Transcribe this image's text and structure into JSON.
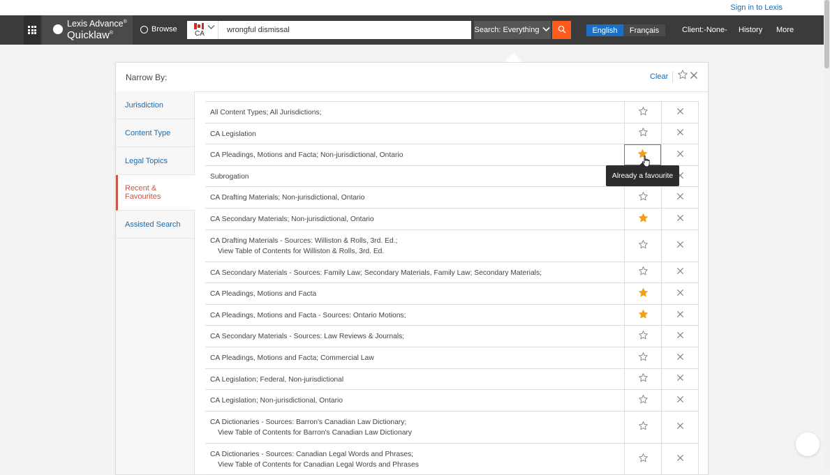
{
  "header": {
    "signin": "Sign in to Lexis",
    "brand_line1": "Lexis Advance",
    "brand_line2": "Quicklaw",
    "brand_mark": "®",
    "browse": "Browse",
    "country": "CA",
    "search_value": "wrongful dismissal",
    "scope": "Search: Everything",
    "lang_en": "English",
    "lang_fr": "Français",
    "client": "Client:-None-",
    "history": "History",
    "more": "More",
    "accent_color": "#ff5b1a",
    "active_lang_color": "#1a6fc7"
  },
  "panel": {
    "title": "Narrow By:",
    "clear": "Clear"
  },
  "sidebar": {
    "items": [
      {
        "label": "Jurisdiction"
      },
      {
        "label": "Content Type"
      },
      {
        "label": "Legal Topics"
      },
      {
        "label": "Recent &\nFavourites"
      },
      {
        "label": "Assisted Search"
      }
    ],
    "active_index": 3
  },
  "rows": [
    {
      "text": "All Content Types; All Jurisdictions;",
      "fav": false
    },
    {
      "text": "CA Legislation",
      "fav": false
    },
    {
      "text": "CA Pleadings, Motions and Facta; Non-jurisdictional, Ontario",
      "fav": true,
      "focused": true
    },
    {
      "text": "Subrogation",
      "fav": false
    },
    {
      "text": "CA Drafting Materials; Non-jurisdictional, Ontario",
      "fav": false
    },
    {
      "text": "CA Secondary Materials; Non-jurisdictional, Ontario",
      "fav": true
    },
    {
      "text": "CA Drafting Materials - Sources: Williston & Rolls, 3rd. Ed.;",
      "sub": "View Table of Contents for Williston & Rolls, 3rd. Ed.",
      "fav": false
    },
    {
      "text": "CA Secondary Materials - Sources: Family Law; Secondary Materials, Family Law; Secondary Materials;",
      "fav": false
    },
    {
      "text": "CA Pleadings, Motions and Facta",
      "fav": true
    },
    {
      "text": "CA Pleadings, Motions and Facta - Sources: Ontario Motions;",
      "fav": true
    },
    {
      "text": "CA Secondary Materials - Sources: Law Reviews & Journals;",
      "fav": false
    },
    {
      "text": "CA Pleadings, Motions and Facta; Commercial Law",
      "fav": false
    },
    {
      "text": "CA Legislation; Federal, Non-jurisdictional",
      "fav": false
    },
    {
      "text": "CA Legislation; Non-jurisdictional, Ontario",
      "fav": false
    },
    {
      "text": "CA Dictionaries - Sources: Barron's Canadian Law Dictionary;",
      "sub": "View Table of Contents for Barron's Canadian Law Dictionary",
      "fav": false
    },
    {
      "text": "CA Dictionaries - Sources: Canadian Legal Words and Phrases;",
      "sub": "View Table of Contents for Canadian Legal Words and Phrases",
      "fav": false
    }
  ],
  "tooltip": "Already a favourite",
  "colors": {
    "star_filled": "#f0a020",
    "star_outline": "#888888",
    "link": "#1a6ab0",
    "active_side": "#c8574a"
  }
}
